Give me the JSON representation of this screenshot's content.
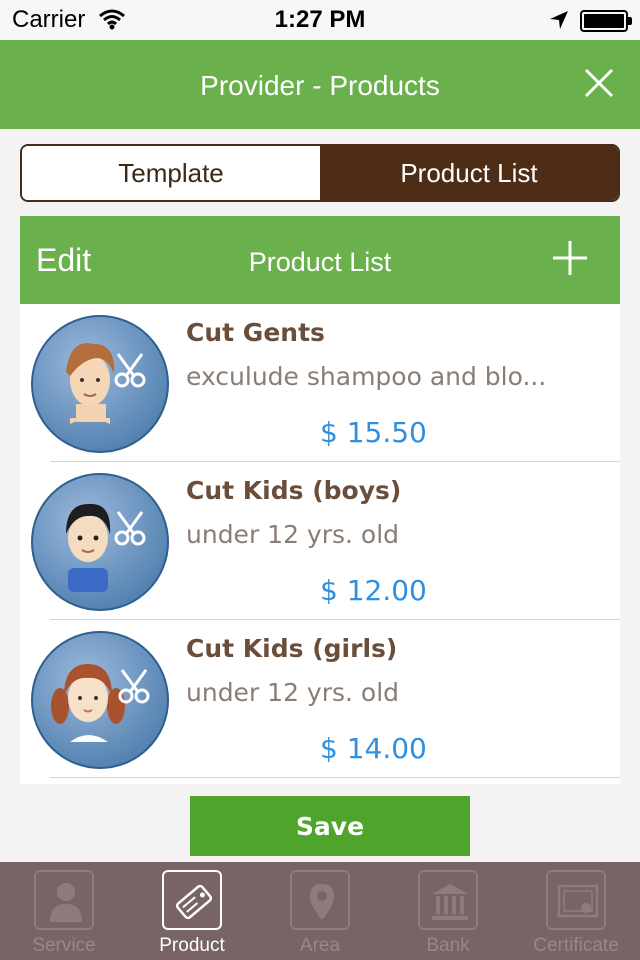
{
  "status": {
    "carrier": "Carrier",
    "time": "1:27 PM",
    "icons": [
      "wifi-icon",
      "location-arrow-icon",
      "battery-icon"
    ]
  },
  "navbar": {
    "title": "Provider - Products",
    "close_icon": "close-icon"
  },
  "segment": {
    "options": [
      "Template",
      "Product List"
    ],
    "selected": "Product List"
  },
  "list_header": {
    "edit_label": "Edit",
    "title": "Product List",
    "add_icon": "plus-icon"
  },
  "products": [
    {
      "name": "Cut Gents",
      "description": "exculude shampoo and blo...",
      "price": "$ 15.50",
      "icon": "man-haircut-avatar"
    },
    {
      "name": "Cut Kids (boys)",
      "description": "under 12 yrs. old",
      "price": "$ 12.00",
      "icon": "boy-haircut-avatar"
    },
    {
      "name": "Cut Kids (girls)",
      "description": "under 12 yrs. old",
      "price": "$ 14.00",
      "icon": "girl-haircut-avatar"
    }
  ],
  "save_label": "Save",
  "tabs": [
    {
      "label": "Service",
      "icon": "person-icon"
    },
    {
      "label": "Product",
      "icon": "price-tag-icon"
    },
    {
      "label": "Area",
      "icon": "map-pin-icon"
    },
    {
      "label": "Bank",
      "icon": "bank-icon"
    },
    {
      "label": "Certificate",
      "icon": "certificate-icon"
    }
  ],
  "active_tab": "Product",
  "colors": {
    "nav_green": "#6ab04c",
    "segment_brown": "#4e2d17",
    "price_blue": "#2f8fe0",
    "save_green": "#4fa42c",
    "tabbar": "#786466"
  }
}
